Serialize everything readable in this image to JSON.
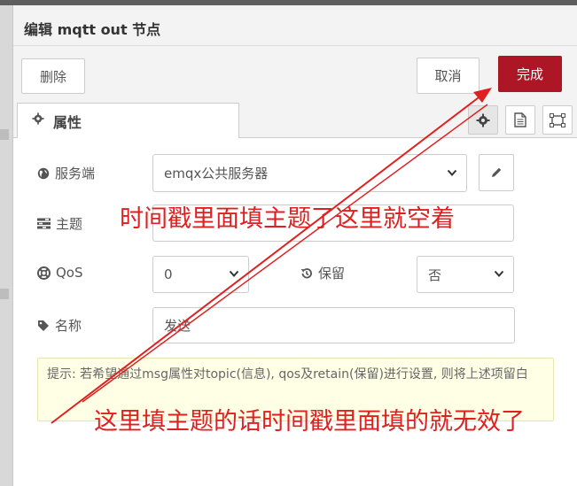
{
  "tray": {
    "title": "编辑 mqtt out 节点"
  },
  "toolbar": {
    "delete_label": "删除",
    "cancel_label": "取消",
    "done_label": "完成"
  },
  "tab": {
    "label": "属性"
  },
  "form": {
    "server_label": "服务端",
    "server_value": "emqx公共服务器",
    "topic_label": "主题",
    "topic_value": "",
    "qos_label": "QoS",
    "qos_value": "0",
    "retain_label": "保留",
    "retain_value": "否",
    "name_label": "名称",
    "name_value": "发送"
  },
  "tip": {
    "text": "提示: 若希望通过msg属性对topic(信息), qos及retain(保留)进行设置, 则将上述项留白"
  },
  "annotations": {
    "top": "时间戳里面填主题了这里就空着",
    "bottom": "这里填主题的话时间戳里面填的就无效了"
  },
  "colors": {
    "done_button": "#ad1625",
    "annotation": "#e02020",
    "tip_background": "#ffffe6"
  }
}
